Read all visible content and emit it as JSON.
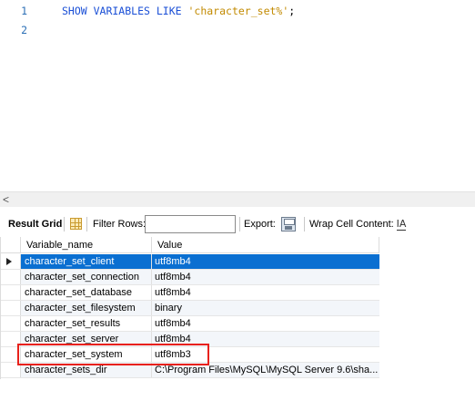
{
  "editor": {
    "lines": [
      {
        "number": "1",
        "keywords": "SHOW VARIABLES LIKE ",
        "string": "'character_set%'",
        "terminator": ";"
      },
      {
        "number": "2"
      }
    ]
  },
  "hscroll": {
    "left_arrow": "<"
  },
  "toolbar": {
    "result_grid_label": "Result Grid",
    "filter_rows_label": "Filter Rows:",
    "filter_rows_value": "",
    "export_label": "Export:",
    "wrap_cell_label": "Wrap Cell Content:",
    "wrap_icon_glyph": "IA"
  },
  "grid": {
    "columns": [
      "Variable_name",
      "Value"
    ],
    "selected_row": 0,
    "highlighted_row": 5,
    "rows": [
      {
        "name": "character_set_client",
        "value": "utf8mb4"
      },
      {
        "name": "character_set_connection",
        "value": "utf8mb4"
      },
      {
        "name": "character_set_database",
        "value": "utf8mb4"
      },
      {
        "name": "character_set_filesystem",
        "value": "binary"
      },
      {
        "name": "character_set_results",
        "value": "utf8mb4"
      },
      {
        "name": "character_set_server",
        "value": "utf8mb4"
      },
      {
        "name": "character_set_system",
        "value": "utf8mb3"
      },
      {
        "name": "character_sets_dir",
        "value": "C:\\Program Files\\MySQL\\MySQL Server 9.6\\sha..."
      }
    ]
  },
  "colors": {
    "selection": "#0a6fd1",
    "highlight_box": "#e8211b",
    "keyword": "#1a4fd6",
    "string": "#c28a00"
  }
}
